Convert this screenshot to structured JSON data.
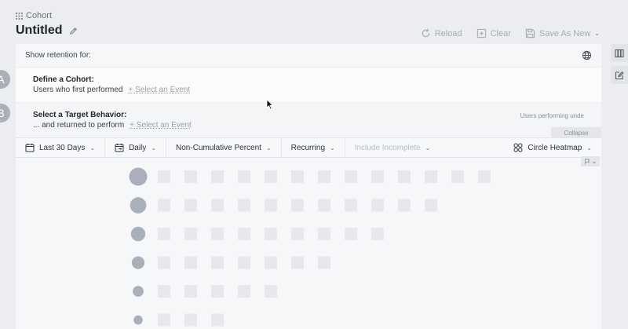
{
  "breadcrumb": {
    "label": "Cohort",
    "icon": "grid-icon"
  },
  "page": {
    "title": "Untitled"
  },
  "toolbar": {
    "reload": "Reload",
    "clear": "Clear",
    "save_as_new": "Save As New"
  },
  "panel": {
    "show_retention_label": "Show retention for:",
    "step_a": {
      "badge": "A",
      "label": "Define a Cohort:",
      "prefix": "Users who first performed",
      "select_event": "+ Select an Event"
    },
    "step_b": {
      "badge": "B",
      "label": "Select a Target Behavior:",
      "prefix": "... and returned to perform",
      "select_event": "+ Select an Event",
      "users_performing": "Users performing unde",
      "collapse": "Collapse"
    }
  },
  "controls": {
    "date_range": "Last 30 Days",
    "interval": "Daily",
    "measure": "Non-Cumulative Percent",
    "retention_type": "Recurring",
    "include_incomplete": "Include Incomplete",
    "viz": "Circle Heatmap"
  },
  "colors": {
    "circle": "#a9b0ba",
    "square": "#e6e8ec",
    "badge": "#a9b0ba"
  },
  "chart_data": {
    "type": "heatmap",
    "rows": [
      {
        "circle_size": 1.0,
        "cells": 13
      },
      {
        "circle_size": 0.9,
        "cells": 11
      },
      {
        "circle_size": 0.8,
        "cells": 9
      },
      {
        "circle_size": 0.7,
        "cells": 7
      },
      {
        "circle_size": 0.6,
        "cells": 5
      },
      {
        "circle_size": 0.5,
        "cells": 3
      }
    ]
  }
}
